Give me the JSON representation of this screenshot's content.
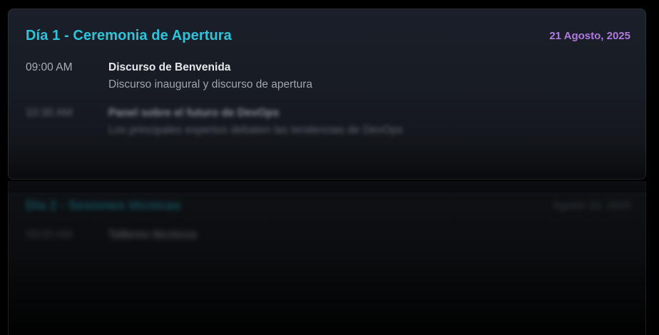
{
  "days": [
    {
      "title": "Día 1 - Ceremonia de Apertura",
      "date": "21 Agosto, 2025",
      "sessions": [
        {
          "time": "09:00 AM",
          "title": "Discurso de Benvenida",
          "description": "Discurso inaugural y discurso de apertura"
        },
        {
          "time": "10:30 AM",
          "title": "Panel sobre el futuro de DevOps",
          "description": "Los principales expertos debaten las tendencias de DevOps"
        }
      ]
    },
    {
      "title": "Día 2 - Sesiones técnicas",
      "date": "Agosto 22, 2025",
      "sessions": [
        {
          "time": "09:00 AM",
          "title": "Talleres técnicos"
        }
      ]
    }
  ],
  "colors": {
    "accent_cyan": "#2ec4dc",
    "accent_purple": "#b07ae0",
    "background": "#000000",
    "card_background": "#1a1f29"
  }
}
